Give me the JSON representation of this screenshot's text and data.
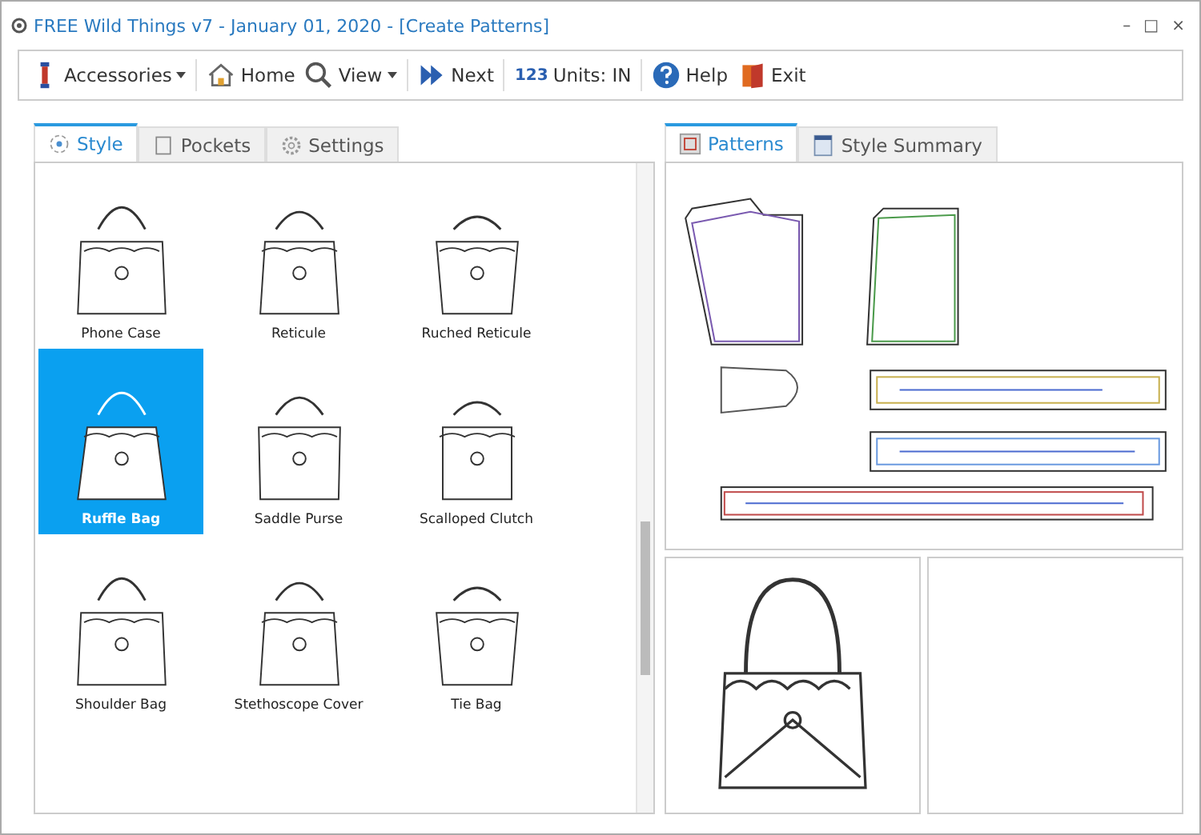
{
  "window": {
    "title": "FREE Wild Things v7 - January 01, 2020 - [Create Patterns]",
    "controls": [
      "–",
      "□",
      "×"
    ]
  },
  "toolbar": [
    {
      "kind": "accessories",
      "label": "Accessories",
      "dropdown": true
    },
    {
      "kind": "home",
      "label": "Home",
      "dropdown": false
    },
    {
      "kind": "view",
      "label": "View",
      "dropdown": true
    },
    {
      "kind": "next",
      "label": "Next",
      "dropdown": false
    },
    {
      "kind": "units",
      "icon_text": "123",
      "label": "Units: IN",
      "dropdown": false
    },
    {
      "kind": "help",
      "label": "Help",
      "dropdown": false
    },
    {
      "kind": "exit",
      "label": "Exit",
      "dropdown": false
    }
  ],
  "left_tabs": [
    {
      "kind": "style",
      "label": "Style",
      "selected": true
    },
    {
      "kind": "pockets",
      "label": "Pockets",
      "selected": false
    },
    {
      "kind": "settings",
      "label": "Settings",
      "selected": false
    }
  ],
  "styles": [
    {
      "label": "Phone Case",
      "selected": false
    },
    {
      "label": "Reticule",
      "selected": false
    },
    {
      "label": "Ruched Reticule",
      "selected": false
    },
    {
      "label": "Ruffle Bag",
      "selected": true
    },
    {
      "label": "Saddle Purse",
      "selected": false
    },
    {
      "label": "Scalloped Clutch",
      "selected": false
    },
    {
      "label": "Shoulder Bag",
      "selected": false
    },
    {
      "label": "Stethoscope Cover",
      "selected": false
    },
    {
      "label": "Tie Bag",
      "selected": false
    }
  ],
  "right_tabs": [
    {
      "kind": "patterns",
      "label": "Patterns",
      "selected": true
    },
    {
      "kind": "summary",
      "label": "Style Summary",
      "selected": false
    }
  ]
}
